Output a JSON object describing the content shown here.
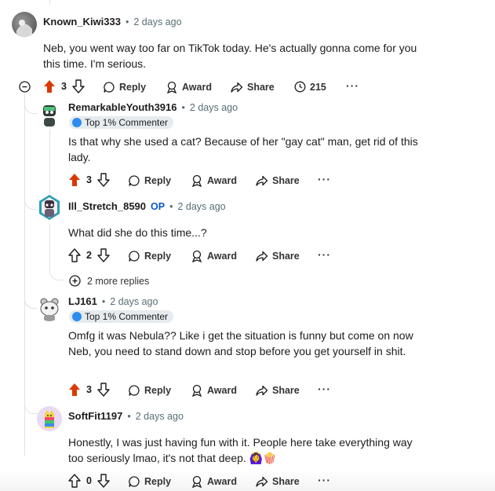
{
  "comments": [
    {
      "author": "Known_Kiwi333",
      "time": "2 days ago",
      "body": "Neb, you went way too far on TikTok today. He's actually gonna come for you this time. I'm serious.",
      "score": "3",
      "upvoted": true,
      "awards_count": "215",
      "actions": {
        "reply": "Reply",
        "award": "Award",
        "share": "Share"
      }
    },
    {
      "author": "RemarkableYouth3916",
      "time": "2 days ago",
      "flair": "Top 1% Commenter",
      "body": "Is that why she used a cat? Because of her \"gay cat\" man, get rid of this lady.",
      "score": "3",
      "upvoted": true,
      "actions": {
        "reply": "Reply",
        "award": "Award",
        "share": "Share"
      }
    },
    {
      "author": "Ill_Stretch_8590",
      "op_label": "OP",
      "time": "2 days ago",
      "body": "What did she do this time...?",
      "score": "2",
      "upvoted": false,
      "more_replies": "2 more replies",
      "actions": {
        "reply": "Reply",
        "award": "Award",
        "share": "Share"
      }
    },
    {
      "author": "LJ161",
      "time": "2 days ago",
      "flair": "Top 1% Commenter",
      "body": "Omfg it was Nebula?? Like i get the situation is funny but come on now Neb, you need to stand down and stop before you get yourself in shit.",
      "score": "3",
      "upvoted": true,
      "actions": {
        "reply": "Reply",
        "award": "Award",
        "share": "Share"
      }
    },
    {
      "author": "SoftFit1197",
      "time": "2 days ago",
      "body": "Honestly, I was just having fun with it. People here take everything way too seriously lmao, it's not that deep. 🙆‍♀️🍿",
      "score": "0",
      "upvoted": false,
      "actions": {
        "reply": "Reply",
        "award": "Award",
        "share": "Share"
      }
    }
  ],
  "colors": {
    "upvote": "#d93a00",
    "op": "#0a58ca",
    "meta": "#576f76",
    "line": "#dfe3e6"
  },
  "separator": "•",
  "more_glyph": "···"
}
